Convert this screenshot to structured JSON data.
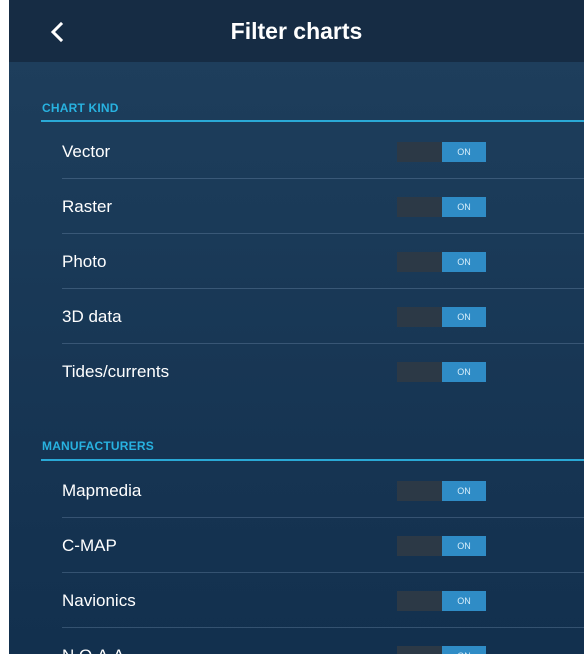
{
  "header": {
    "title": "Filter charts",
    "back_icon": "chevron-left-icon"
  },
  "sections": [
    {
      "title": "CHART KIND",
      "items": [
        {
          "label": "Vector",
          "toggle": "ON"
        },
        {
          "label": "Raster",
          "toggle": "ON"
        },
        {
          "label": "Photo",
          "toggle": "ON"
        },
        {
          "label": "3D data",
          "toggle": "ON"
        },
        {
          "label": "Tides/currents",
          "toggle": "ON"
        }
      ]
    },
    {
      "title": "MANUFACTURERS",
      "items": [
        {
          "label": "Mapmedia",
          "toggle": "ON"
        },
        {
          "label": "C-MAP",
          "toggle": "ON"
        },
        {
          "label": "Navionics",
          "toggle": "ON"
        },
        {
          "label": "N.O.A.A.",
          "toggle": "ON"
        }
      ]
    }
  ],
  "colors": {
    "accent": "#28b2e0",
    "toggle_on": "#2f8cc6",
    "toggle_track": "#2c3946",
    "header_bg": "#162c44"
  }
}
